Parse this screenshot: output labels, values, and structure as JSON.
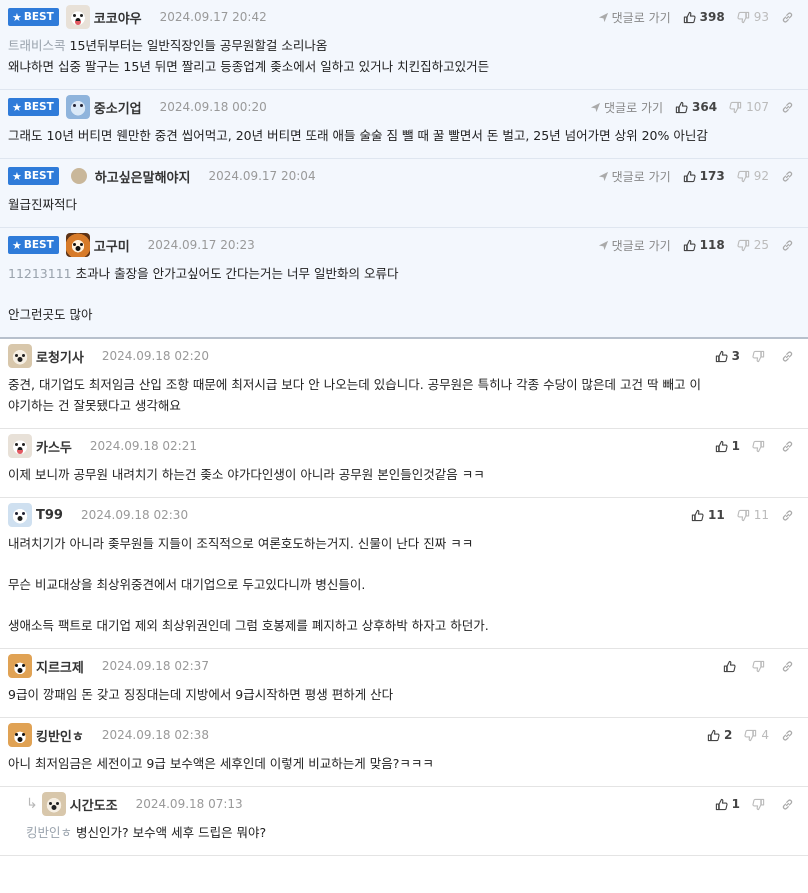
{
  "reply_label": "댓글로 가기",
  "best_label": "BEST",
  "comments": [
    {
      "nick": "코코야우",
      "date": "2024.09.17 20:42",
      "mention": "트래비스콕",
      "lines": [
        "15년뒤부터는 일반직장인들 공무원할걸 소리나옴",
        "왜냐하면 십중 팔구는 15년 뒤면 짤리고 등종업계 좆소에서 일하고 있거나 치킨집하고있거든"
      ],
      "up": "398",
      "down": "93"
    },
    {
      "nick": "중소기업",
      "date": "2024.09.18 00:20",
      "lines": [
        "그래도 10년 버티면 웬만한 중견 씹어먹고, 20년 버티면 또래 애들 술술 짐 뺄 때 꿀 빨면서 돈 벌고, 25년 넘어가면 상위 20% 아닌감"
      ],
      "up": "364",
      "down": "107"
    },
    {
      "nick": "하고싶은말해야지",
      "date": "2024.09.17 20:04",
      "lines": [
        "월급진짜적다"
      ],
      "up": "173",
      "down": "92"
    },
    {
      "nick": "고구미",
      "date": "2024.09.17 20:23",
      "mention": "11213111",
      "lines": [
        "초과나 출장을 안가고싶어도 간다는거는 너무 일반화의 오류다",
        "",
        "안그런곳도 많아"
      ],
      "up": "118",
      "down": "25"
    },
    {
      "nick": "로청기사",
      "date": "2024.09.18 02:20",
      "lines": [
        "중견, 대기업도 최저임금 산입 조항 때문에 최저시급 보다 안 나오는데 있습니다. 공무원은 특히나 각종 수당이 많은데 고건 딱 빼고 이",
        "야기하는 건 잘못됐다고 생각해요"
      ],
      "up": "3",
      "down": ""
    },
    {
      "nick": "카스두",
      "date": "2024.09.18 02:21",
      "lines": [
        "이제 보니까 공무원 내려치기 하는건 좆소 야가다인생이 아니라 공무원 본인들인것같음 ㅋㅋ"
      ],
      "up": "1",
      "down": ""
    },
    {
      "nick": "T99",
      "date": "2024.09.18 02:30",
      "lines": [
        "내려치기가 아니라 좆무원들 지들이 조직적으로 여론호도하는거지. 신물이 난다 진짜 ㅋㅋ",
        "",
        "무슨 비교대상을 최상위중견에서 대기업으로 두고있다니까 병신들이.",
        "",
        "생애소득 팩트로 대기업 제외 최상위권인데 그럼 호봉제를 폐지하고 상후하박 하자고 하던가."
      ],
      "up": "11",
      "down": "11"
    },
    {
      "nick": "지르크제",
      "date": "2024.09.18 02:37",
      "lines": [
        "9급이 깡패임 돈 갖고 징징대는데 지방에서 9급시작하면 평생 편하게 산다"
      ],
      "up": "",
      "down": ""
    },
    {
      "nick": "킹반인ㅎ",
      "date": "2024.09.18 02:38",
      "lines": [
        "아니 최저임금은 세전이고 9급 보수액은 세후인데 이렇게 비교하는게 맞음?ㅋㅋㅋ"
      ],
      "up": "2",
      "down": "4"
    },
    {
      "nick": "시간도조",
      "date": "2024.09.18 07:13",
      "mention": "킹반인ㅎ",
      "lines": [
        "병신인가? 보수액 세후 드립은 뭐야?"
      ],
      "up": "1",
      "down": ""
    }
  ]
}
